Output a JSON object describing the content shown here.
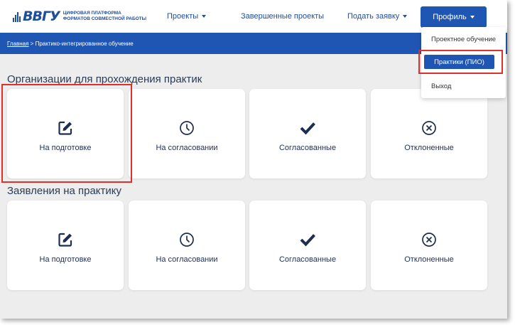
{
  "header": {
    "logo_mark": "ВВГУ",
    "logo_line1": "ЦИФРОВАЯ ПЛАТФОРМА",
    "logo_line2": "ФОРМАТОВ СОВМЕСТНОЙ РАБОТЫ",
    "nav": {
      "projects": "Проекты",
      "completed": "Завершенные проекты",
      "apply": "Подать заявку"
    },
    "profile_label": "Профиль"
  },
  "breadcrumb": {
    "home": "Главная",
    "separator": " > ",
    "current": "Практико-интегрированное обучение"
  },
  "dropdown": {
    "items": [
      "Проектное обучение",
      "Практики (ПИО)",
      "Выход"
    ],
    "active_index": 1
  },
  "sections": [
    {
      "title": "Организации для прохождения практик",
      "cards": [
        {
          "label": "На подготовке",
          "icon": "edit-icon"
        },
        {
          "label": "На согласовании",
          "icon": "clock-icon"
        },
        {
          "label": "Согласованные",
          "icon": "check-icon"
        },
        {
          "label": "Отклоненные",
          "icon": "x-circle-icon"
        }
      ]
    },
    {
      "title": "Заявления на практику",
      "cards": [
        {
          "label": "На подготовке",
          "icon": "edit-icon"
        },
        {
          "label": "На согласовании",
          "icon": "clock-icon"
        },
        {
          "label": "Согласованные",
          "icon": "check-icon"
        },
        {
          "label": "Отклоненные",
          "icon": "x-circle-icon"
        }
      ]
    }
  ],
  "colors": {
    "primary": "#1f55b3",
    "brand": "#1e4e9c",
    "background": "#ededed",
    "highlight": "#e0302c",
    "text": "#21335a"
  }
}
